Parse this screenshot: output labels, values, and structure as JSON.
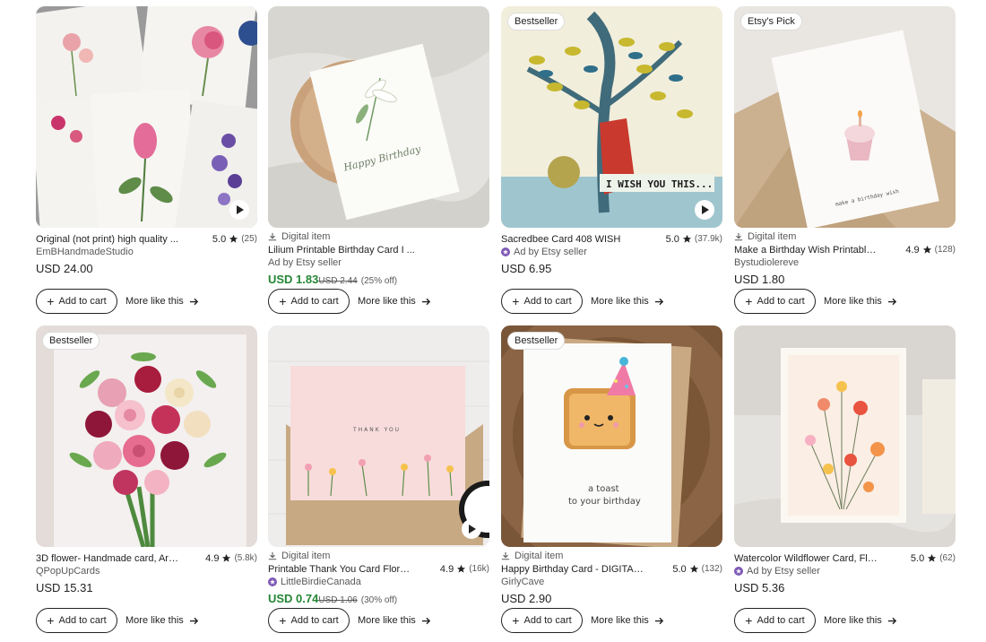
{
  "labels": {
    "add_to_cart": "Add to cart",
    "more_like_this": "More like this",
    "digital_item": "Digital item"
  },
  "products": [
    {
      "badge": "",
      "digital": false,
      "video": true,
      "title": "Original (not print) high quality ...",
      "rating": "5.0",
      "count": "(25)",
      "shop": "EmBHandmadeStudio",
      "ad": false,
      "price": "USD 24.00",
      "sale": false
    },
    {
      "badge": "",
      "digital": true,
      "video": false,
      "title": "Lilium Printable Birthday Card I ...",
      "rating": "",
      "count": "",
      "shop": "Ad by Etsy seller",
      "ad": true,
      "price": "USD 1.83",
      "was": "USD 2.44",
      "pct": "(25% off)",
      "sale": true
    },
    {
      "badge": "Bestseller",
      "digital": false,
      "video": true,
      "title": "Sacredbee Card 408 WISH",
      "rating": "5.0",
      "count": "(37.9k)",
      "shop": "Ad by Etsy seller",
      "ad": true,
      "price": "USD 6.95",
      "sale": false
    },
    {
      "badge": "Etsy's Pick",
      "digital": true,
      "video": false,
      "title": "Make a Birthday Wish Printable B...",
      "rating": "4.9",
      "count": "(128)",
      "shop": "Bystudiolereve",
      "ad": false,
      "price": "USD 1.80",
      "sale": false
    },
    {
      "badge": "Bestseller",
      "digital": false,
      "video": false,
      "title": "3D flower- Handmade card, Art ...",
      "rating": "4.9",
      "count": "(5.8k)",
      "shop": "QPopUpCards",
      "ad": false,
      "price": "USD 15.31",
      "sale": false
    },
    {
      "badge": "",
      "digital": true,
      "video": true,
      "title": "Printable Thank You Card Floral ...",
      "rating": "4.9",
      "count": "(16k)",
      "shop": "LittleBirdieCanada",
      "ad": true,
      "price": "USD 0.74",
      "was": "USD 1.06",
      "pct": "(30% off)",
      "sale": true
    },
    {
      "badge": "Bestseller",
      "digital": true,
      "video": false,
      "title": "Happy Birthday Card - DIGITAL D...",
      "rating": "5.0",
      "count": "(132)",
      "shop": "GirlyCave",
      "ad": false,
      "price": "USD 2.90",
      "sale": false
    },
    {
      "badge": "",
      "digital": false,
      "video": false,
      "title": "Watercolor Wildflower Card, Flor...",
      "rating": "5.0",
      "count": "(62)",
      "shop": "Ad by Etsy seller",
      "ad": true,
      "price": "USD 5.36",
      "sale": false
    }
  ],
  "image_text": {
    "lilium_card": "Happy Birthday",
    "wish_card": "I WISH YOU THIS...",
    "cupcake_card": "make a birthday wish",
    "thankyou_card": "THANK YOU",
    "toast_card_line1": "a toast",
    "toast_card_line2": "to your birthday"
  },
  "colors": {
    "sale_green": "#258635",
    "text": "#222222",
    "muted": "#595959",
    "star_purple": "#7f5ab6"
  },
  "icons": {
    "star": "star-icon",
    "play": "play-icon",
    "download": "download-icon",
    "arrow": "arrow-right-icon",
    "seller": "star-seller-icon"
  }
}
